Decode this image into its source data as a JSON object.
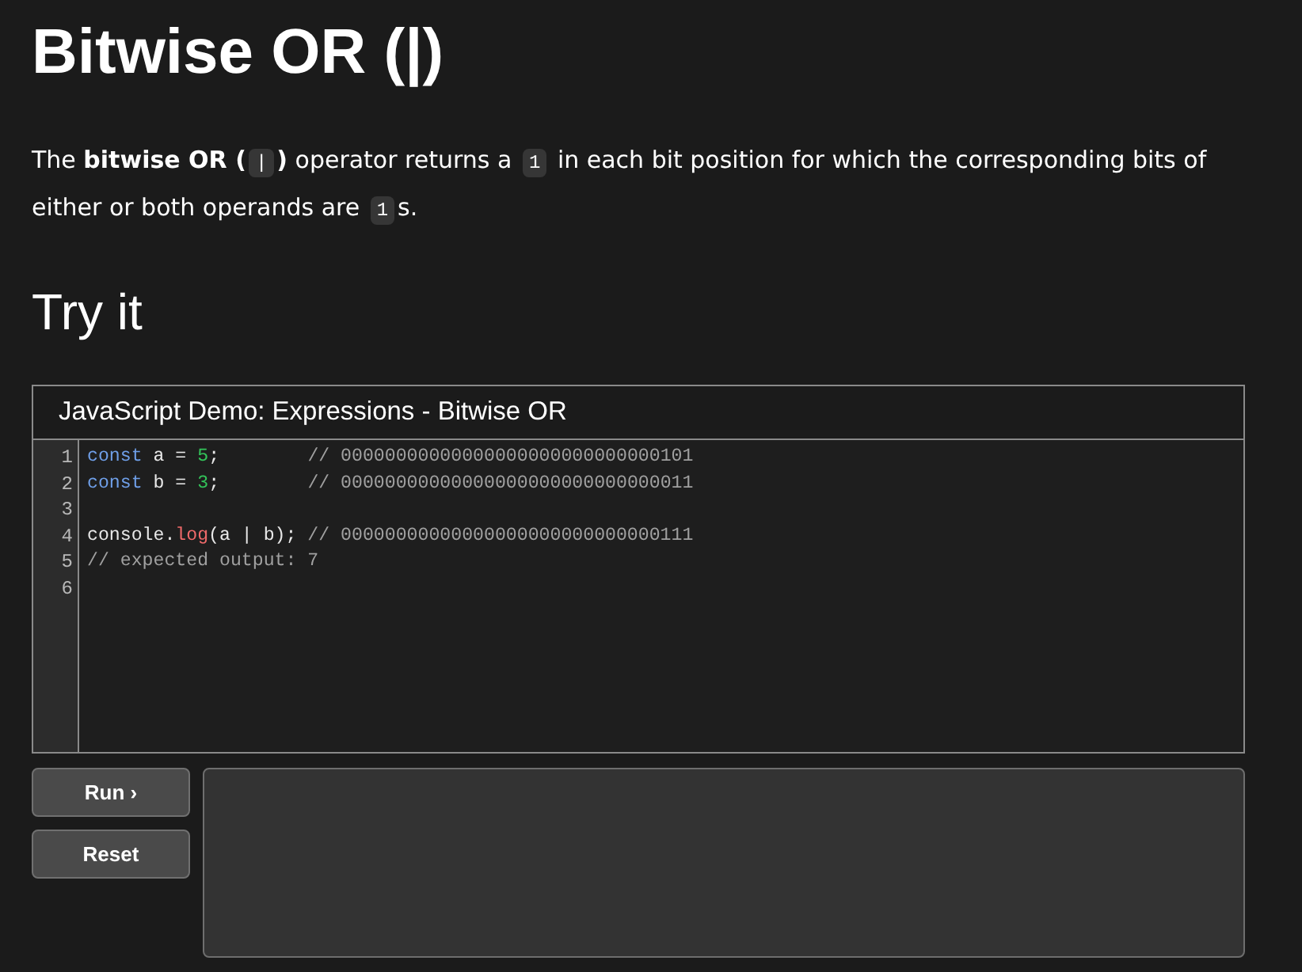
{
  "title": "Bitwise OR (|)",
  "description": [
    {
      "kind": "text",
      "text": "The "
    },
    {
      "kind": "bold",
      "text": "bitwise OR ("
    },
    {
      "kind": "code",
      "text": "|"
    },
    {
      "kind": "bold",
      "text": ")"
    },
    {
      "kind": "text",
      "text": " operator returns a "
    },
    {
      "kind": "code",
      "text": "1"
    },
    {
      "kind": "text",
      "text": " in each bit position for which the corresponding bits of either or both operands are "
    },
    {
      "kind": "code",
      "text": "1"
    },
    {
      "kind": "text",
      "text": "s."
    }
  ],
  "section_heading": "Try it",
  "demo": {
    "title": "JavaScript Demo: Expressions - Bitwise OR",
    "code_lines": [
      {
        "number": "1",
        "tokens": [
          {
            "kind": "keyword",
            "text": "const"
          },
          {
            "kind": "plain",
            "text": " a = "
          },
          {
            "kind": "number",
            "text": "5"
          },
          {
            "kind": "plain",
            "text": ";        "
          },
          {
            "kind": "comment",
            "text": "// 00000000000000000000000000000101"
          }
        ]
      },
      {
        "number": "2",
        "tokens": [
          {
            "kind": "keyword",
            "text": "const"
          },
          {
            "kind": "plain",
            "text": " b = "
          },
          {
            "kind": "number",
            "text": "3"
          },
          {
            "kind": "plain",
            "text": ";        "
          },
          {
            "kind": "comment",
            "text": "// 00000000000000000000000000000011"
          }
        ]
      },
      {
        "number": "3"
      },
      {
        "number": "4",
        "tokens": [
          {
            "kind": "plain",
            "text": "console."
          },
          {
            "kind": "function",
            "text": "log"
          },
          {
            "kind": "plain",
            "text": "(a | b); "
          },
          {
            "kind": "comment",
            "text": "// 00000000000000000000000000000111"
          }
        ]
      },
      {
        "number": "5",
        "tokens": [
          {
            "kind": "comment",
            "text": "// expected output: 7"
          }
        ]
      },
      {
        "number": "6"
      }
    ],
    "run_button": {
      "label": "Run ›"
    },
    "reset_button": {
      "label": "Reset"
    }
  }
}
